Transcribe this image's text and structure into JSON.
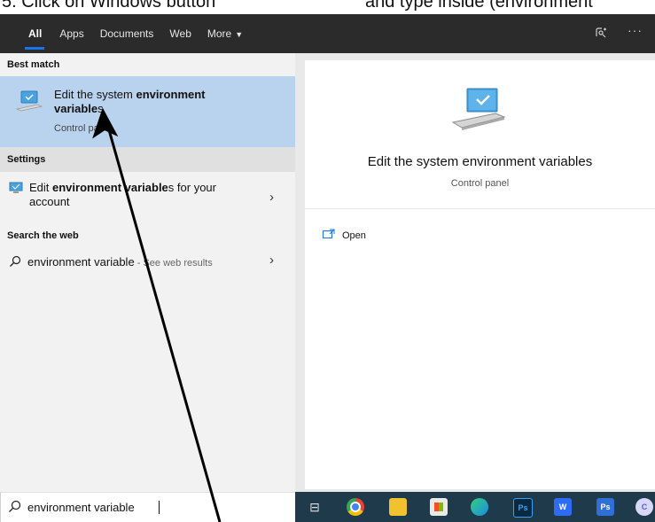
{
  "caption": {
    "left": "5.   Click on Windows button",
    "right": "and type inside (environment"
  },
  "tabs": [
    {
      "label": "All",
      "active": true
    },
    {
      "label": "Apps"
    },
    {
      "label": "Documents"
    },
    {
      "label": "Web"
    },
    {
      "label": "More"
    }
  ],
  "topbar_icons": {
    "feedback": "feedback-icon",
    "more": "more-options-icon"
  },
  "best_match": {
    "header": "Best match",
    "title_pre": "Edit the system ",
    "title_bold1": "environment",
    "title_bold2": "variable",
    "title_post": "s",
    "subtitle": "Control panel"
  },
  "settings": {
    "header": "Settings",
    "item_pre": "Edit ",
    "item_bold": "environment variable",
    "item_post": "s for your",
    "item_line2": "account"
  },
  "web": {
    "header": "Search the web",
    "query": "environment variable",
    "suffix": " - See web results"
  },
  "detail": {
    "title": "Edit the system environment variables",
    "subtitle": "Control panel",
    "action": "Open"
  },
  "search": {
    "value": "environment variable"
  },
  "taskbar_icons": [
    {
      "name": "task-view-icon",
      "glyph": "⊟"
    },
    {
      "name": "chrome-icon",
      "glyph": ""
    },
    {
      "name": "file-explorer-icon",
      "glyph": ""
    },
    {
      "name": "store-icon",
      "glyph": ""
    },
    {
      "name": "edge-icon",
      "glyph": ""
    },
    {
      "name": "photoshop-icon",
      "glyph": "Ps"
    },
    {
      "name": "wps-icon",
      "glyph": "W"
    },
    {
      "name": "photoshop-icon-2",
      "glyph": "Ps"
    },
    {
      "name": "browser-icon",
      "glyph": ""
    }
  ],
  "colors": {
    "selected_bg": "#b9d3ef",
    "tab_underline": "#1a73e8",
    "taskbar": "#1f3a4a"
  }
}
